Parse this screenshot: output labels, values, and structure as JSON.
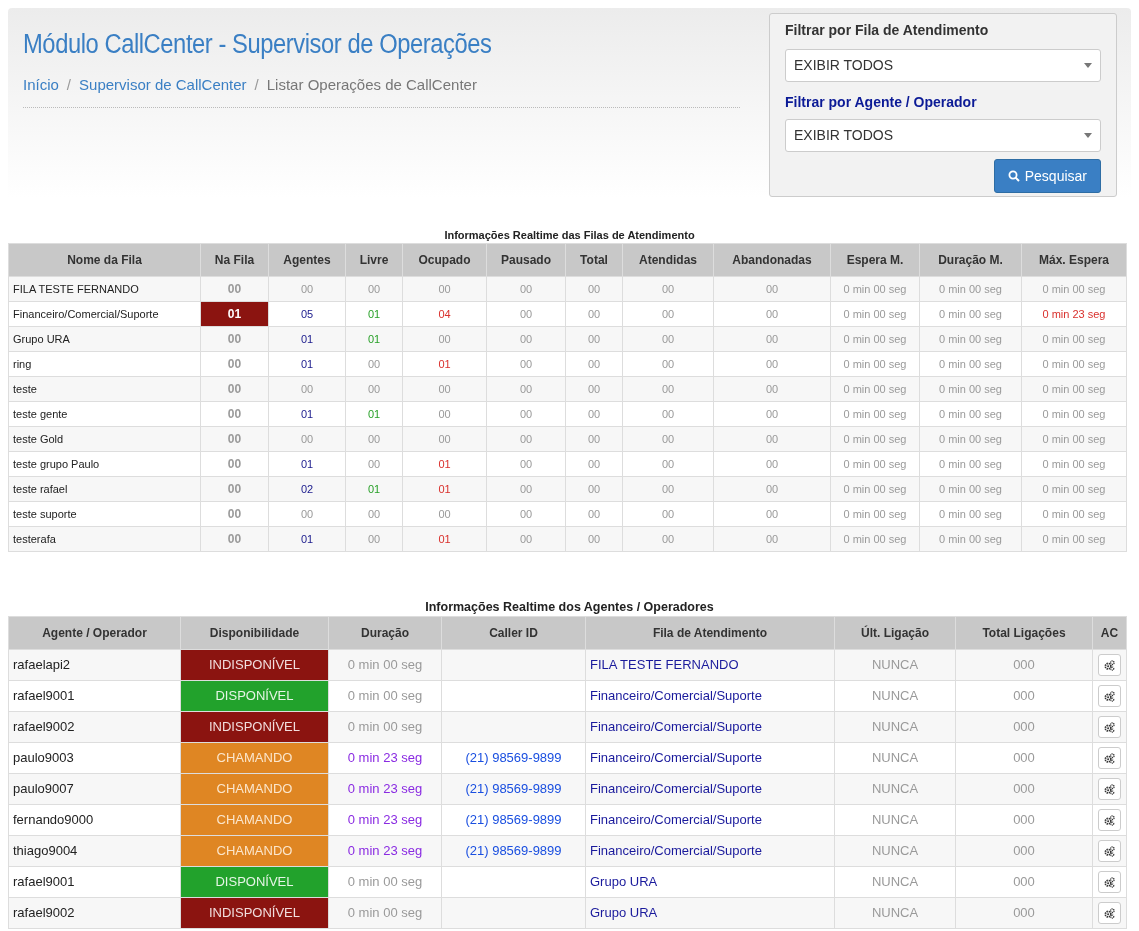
{
  "header": {
    "title": "Módulo CallCenter - Supervisor de Operações",
    "breadcrumb": [
      {
        "label": "Início",
        "kind": "link"
      },
      {
        "separator": "/",
        "label": "Supervisor de CallCenter",
        "kind": "link"
      },
      {
        "separator": "/",
        "label": "Listar Operações de CallCenter",
        "kind": "current"
      }
    ]
  },
  "filters": {
    "queue_label": "Filtrar por Fila de Atendimento",
    "queue_value": "EXIBIR TODOS",
    "agent_label": "Filtrar por Agente / Operador",
    "agent_value": "EXIBIR TODOS",
    "search_button": "Pesquisar"
  },
  "queues_table": {
    "title": "Informações Realtime das Filas de Atendimento",
    "columns": [
      "Nome da Fila",
      "Na Fila",
      "Agentes",
      "Livre",
      "Ocupado",
      "Pausado",
      "Total",
      "Atendidas",
      "Abandonadas",
      "Espera M.",
      "Duração M.",
      "Máx. Espera"
    ],
    "rows": [
      [
        {
          "text": "FILA TESTE FERNANDO",
          "kind": "name"
        },
        {
          "text": "00",
          "kind": "waiting"
        },
        {
          "text": "00",
          "kind": "zero"
        },
        {
          "text": "00",
          "kind": "zero"
        },
        {
          "text": "00",
          "kind": "zero"
        },
        {
          "text": "00",
          "kind": "zero"
        },
        {
          "text": "00",
          "kind": "zero"
        },
        {
          "text": "00",
          "kind": "zero"
        },
        {
          "text": "00",
          "kind": "zero"
        },
        {
          "text": "0 min 00 seg",
          "kind": "zero"
        },
        {
          "text": "0 min 00 seg",
          "kind": "zero"
        },
        {
          "text": "0 min 00 seg",
          "kind": "zero"
        }
      ],
      [
        {
          "text": "Financeiro/Comercial/Suporte",
          "kind": "name"
        },
        {
          "text": "01",
          "kind": "alert"
        },
        {
          "text": "05",
          "kind": "blue"
        },
        {
          "text": "01",
          "kind": "green"
        },
        {
          "text": "04",
          "kind": "red"
        },
        {
          "text": "00",
          "kind": "zero"
        },
        {
          "text": "00",
          "kind": "zero"
        },
        {
          "text": "00",
          "kind": "zero"
        },
        {
          "text": "00",
          "kind": "zero"
        },
        {
          "text": "0 min 00 seg",
          "kind": "zero"
        },
        {
          "text": "0 min 00 seg",
          "kind": "zero"
        },
        {
          "text": "0 min 23 seg",
          "kind": "red"
        }
      ],
      [
        {
          "text": "Grupo URA",
          "kind": "name"
        },
        {
          "text": "00",
          "kind": "waiting"
        },
        {
          "text": "01",
          "kind": "blue"
        },
        {
          "text": "01",
          "kind": "green"
        },
        {
          "text": "00",
          "kind": "zero"
        },
        {
          "text": "00",
          "kind": "zero"
        },
        {
          "text": "00",
          "kind": "zero"
        },
        {
          "text": "00",
          "kind": "zero"
        },
        {
          "text": "00",
          "kind": "zero"
        },
        {
          "text": "0 min 00 seg",
          "kind": "zero"
        },
        {
          "text": "0 min 00 seg",
          "kind": "zero"
        },
        {
          "text": "0 min 00 seg",
          "kind": "zero"
        }
      ],
      [
        {
          "text": "ring",
          "kind": "name"
        },
        {
          "text": "00",
          "kind": "waiting"
        },
        {
          "text": "01",
          "kind": "blue"
        },
        {
          "text": "00",
          "kind": "zero"
        },
        {
          "text": "01",
          "kind": "red"
        },
        {
          "text": "00",
          "kind": "zero"
        },
        {
          "text": "00",
          "kind": "zero"
        },
        {
          "text": "00",
          "kind": "zero"
        },
        {
          "text": "00",
          "kind": "zero"
        },
        {
          "text": "0 min 00 seg",
          "kind": "zero"
        },
        {
          "text": "0 min 00 seg",
          "kind": "zero"
        },
        {
          "text": "0 min 00 seg",
          "kind": "zero"
        }
      ],
      [
        {
          "text": "teste",
          "kind": "name"
        },
        {
          "text": "00",
          "kind": "waiting"
        },
        {
          "text": "00",
          "kind": "zero"
        },
        {
          "text": "00",
          "kind": "zero"
        },
        {
          "text": "00",
          "kind": "zero"
        },
        {
          "text": "00",
          "kind": "zero"
        },
        {
          "text": "00",
          "kind": "zero"
        },
        {
          "text": "00",
          "kind": "zero"
        },
        {
          "text": "00",
          "kind": "zero"
        },
        {
          "text": "0 min 00 seg",
          "kind": "zero"
        },
        {
          "text": "0 min 00 seg",
          "kind": "zero"
        },
        {
          "text": "0 min 00 seg",
          "kind": "zero"
        }
      ],
      [
        {
          "text": "teste gente",
          "kind": "name"
        },
        {
          "text": "00",
          "kind": "waiting"
        },
        {
          "text": "01",
          "kind": "blue"
        },
        {
          "text": "01",
          "kind": "green"
        },
        {
          "text": "00",
          "kind": "zero"
        },
        {
          "text": "00",
          "kind": "zero"
        },
        {
          "text": "00",
          "kind": "zero"
        },
        {
          "text": "00",
          "kind": "zero"
        },
        {
          "text": "00",
          "kind": "zero"
        },
        {
          "text": "0 min 00 seg",
          "kind": "zero"
        },
        {
          "text": "0 min 00 seg",
          "kind": "zero"
        },
        {
          "text": "0 min 00 seg",
          "kind": "zero"
        }
      ],
      [
        {
          "text": "teste Gold",
          "kind": "name"
        },
        {
          "text": "00",
          "kind": "waiting"
        },
        {
          "text": "00",
          "kind": "zero"
        },
        {
          "text": "00",
          "kind": "zero"
        },
        {
          "text": "00",
          "kind": "zero"
        },
        {
          "text": "00",
          "kind": "zero"
        },
        {
          "text": "00",
          "kind": "zero"
        },
        {
          "text": "00",
          "kind": "zero"
        },
        {
          "text": "00",
          "kind": "zero"
        },
        {
          "text": "0 min 00 seg",
          "kind": "zero"
        },
        {
          "text": "0 min 00 seg",
          "kind": "zero"
        },
        {
          "text": "0 min 00 seg",
          "kind": "zero"
        }
      ],
      [
        {
          "text": "teste grupo Paulo",
          "kind": "name"
        },
        {
          "text": "00",
          "kind": "waiting"
        },
        {
          "text": "01",
          "kind": "blue"
        },
        {
          "text": "00",
          "kind": "zero"
        },
        {
          "text": "01",
          "kind": "red"
        },
        {
          "text": "00",
          "kind": "zero"
        },
        {
          "text": "00",
          "kind": "zero"
        },
        {
          "text": "00",
          "kind": "zero"
        },
        {
          "text": "00",
          "kind": "zero"
        },
        {
          "text": "0 min 00 seg",
          "kind": "zero"
        },
        {
          "text": "0 min 00 seg",
          "kind": "zero"
        },
        {
          "text": "0 min 00 seg",
          "kind": "zero"
        }
      ],
      [
        {
          "text": "teste rafael",
          "kind": "name"
        },
        {
          "text": "00",
          "kind": "waiting"
        },
        {
          "text": "02",
          "kind": "blue"
        },
        {
          "text": "01",
          "kind": "green"
        },
        {
          "text": "01",
          "kind": "red"
        },
        {
          "text": "00",
          "kind": "zero"
        },
        {
          "text": "00",
          "kind": "zero"
        },
        {
          "text": "00",
          "kind": "zero"
        },
        {
          "text": "00",
          "kind": "zero"
        },
        {
          "text": "0 min 00 seg",
          "kind": "zero"
        },
        {
          "text": "0 min 00 seg",
          "kind": "zero"
        },
        {
          "text": "0 min 00 seg",
          "kind": "zero"
        }
      ],
      [
        {
          "text": "teste suporte",
          "kind": "name"
        },
        {
          "text": "00",
          "kind": "waiting"
        },
        {
          "text": "00",
          "kind": "zero"
        },
        {
          "text": "00",
          "kind": "zero"
        },
        {
          "text": "00",
          "kind": "zero"
        },
        {
          "text": "00",
          "kind": "zero"
        },
        {
          "text": "00",
          "kind": "zero"
        },
        {
          "text": "00",
          "kind": "zero"
        },
        {
          "text": "00",
          "kind": "zero"
        },
        {
          "text": "0 min 00 seg",
          "kind": "zero"
        },
        {
          "text": "0 min 00 seg",
          "kind": "zero"
        },
        {
          "text": "0 min 00 seg",
          "kind": "zero"
        }
      ],
      [
        {
          "text": "testerafa",
          "kind": "name"
        },
        {
          "text": "00",
          "kind": "waiting"
        },
        {
          "text": "01",
          "kind": "blue"
        },
        {
          "text": "00",
          "kind": "zero"
        },
        {
          "text": "01",
          "kind": "red"
        },
        {
          "text": "00",
          "kind": "zero"
        },
        {
          "text": "00",
          "kind": "zero"
        },
        {
          "text": "00",
          "kind": "zero"
        },
        {
          "text": "00",
          "kind": "zero"
        },
        {
          "text": "0 min 00 seg",
          "kind": "zero"
        },
        {
          "text": "0 min 00 seg",
          "kind": "zero"
        },
        {
          "text": "0 min 00 seg",
          "kind": "zero"
        }
      ]
    ]
  },
  "agents_table": {
    "title": "Informações Realtime dos Agentes / Operadores",
    "columns": [
      "Agente / Operador",
      "Disponibilidade",
      "Duração",
      "Caller ID",
      "Fila de Atendimento",
      "Últ. Ligação",
      "Total Ligações",
      "AC"
    ],
    "rows": [
      {
        "agent": "rafaelapi2",
        "status": {
          "text": "INDISPONÍVEL",
          "kind": "unavailable"
        },
        "duration": {
          "text": "0 min 00 seg",
          "kind": "idle"
        },
        "queue": "FILA TESTE FERNANDO",
        "last_call": "NUNCA",
        "total_calls": "000"
      },
      {
        "agent": "rafael9001",
        "status": {
          "text": "DISPONÍVEL",
          "kind": "available"
        },
        "duration": {
          "text": "0 min 00 seg",
          "kind": "idle"
        },
        "queue": "Financeiro/Comercial/Suporte",
        "last_call": "NUNCA",
        "total_calls": "000"
      },
      {
        "agent": "rafael9002",
        "status": {
          "text": "INDISPONÍVEL",
          "kind": "unavailable"
        },
        "duration": {
          "text": "0 min 00 seg",
          "kind": "idle"
        },
        "queue": "Financeiro/Comercial/Suporte",
        "last_call": "NUNCA",
        "total_calls": "000"
      },
      {
        "agent": "paulo9003",
        "status": {
          "text": "CHAMANDO",
          "kind": "calling"
        },
        "duration": {
          "text": "0 min 23 seg",
          "kind": "active"
        },
        "caller_id": "(21) 98569-9899",
        "queue": "Financeiro/Comercial/Suporte",
        "last_call": "NUNCA",
        "total_calls": "000"
      },
      {
        "agent": "paulo9007",
        "status": {
          "text": "CHAMANDO",
          "kind": "calling"
        },
        "duration": {
          "text": "0 min 23 seg",
          "kind": "active"
        },
        "caller_id": "(21) 98569-9899",
        "queue": "Financeiro/Comercial/Suporte",
        "last_call": "NUNCA",
        "total_calls": "000"
      },
      {
        "agent": "fernando9000",
        "status": {
          "text": "CHAMANDO",
          "kind": "calling"
        },
        "duration": {
          "text": "0 min 23 seg",
          "kind": "active"
        },
        "caller_id": "(21) 98569-9899",
        "queue": "Financeiro/Comercial/Suporte",
        "last_call": "NUNCA",
        "total_calls": "000"
      },
      {
        "agent": "thiago9004",
        "status": {
          "text": "CHAMANDO",
          "kind": "calling"
        },
        "duration": {
          "text": "0 min 23 seg",
          "kind": "active"
        },
        "caller_id": "(21) 98569-9899",
        "queue": "Financeiro/Comercial/Suporte",
        "last_call": "NUNCA",
        "total_calls": "000"
      },
      {
        "agent": "rafael9001",
        "status": {
          "text": "DISPONÍVEL",
          "kind": "available"
        },
        "duration": {
          "text": "0 min 00 seg",
          "kind": "idle"
        },
        "queue": "Grupo URA",
        "last_call": "NUNCA",
        "total_calls": "000"
      },
      {
        "agent": "rafael9002",
        "status": {
          "text": "INDISPONÍVEL",
          "kind": "unavailable"
        },
        "duration": {
          "text": "0 min 00 seg",
          "kind": "idle"
        },
        "queue": "Grupo URA",
        "last_call": "NUNCA",
        "total_calls": "000"
      }
    ]
  }
}
